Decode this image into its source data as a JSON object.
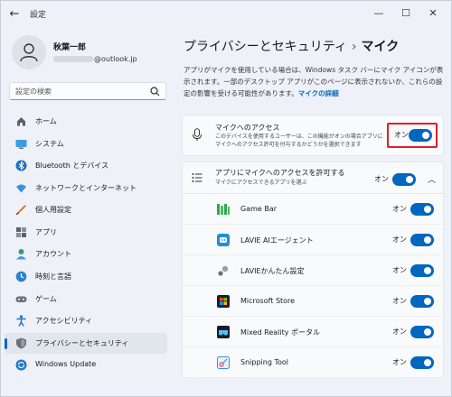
{
  "window": {
    "title": "設定"
  },
  "user": {
    "name": "秋葉一郎",
    "email_suffix": "@outlook.jp"
  },
  "search": {
    "placeholder": "設定の検索"
  },
  "nav": [
    {
      "label": "ホーム",
      "icon": "home-icon"
    },
    {
      "label": "システム",
      "icon": "system-icon"
    },
    {
      "label": "Bluetooth とデバイス",
      "icon": "bluetooth-icon"
    },
    {
      "label": "ネットワークとインターネット",
      "icon": "network-icon"
    },
    {
      "label": "個人用設定",
      "icon": "personalization-icon"
    },
    {
      "label": "アプリ",
      "icon": "apps-icon"
    },
    {
      "label": "アカウント",
      "icon": "accounts-icon"
    },
    {
      "label": "時刻と言語",
      "icon": "time-language-icon"
    },
    {
      "label": "ゲーム",
      "icon": "gaming-icon"
    },
    {
      "label": "アクセシビリティ",
      "icon": "accessibility-icon"
    },
    {
      "label": "プライバシーとセキュリティ",
      "icon": "privacy-shield-icon",
      "active": true
    },
    {
      "label": "Windows Update",
      "icon": "windows-update-icon"
    }
  ],
  "breadcrumb": {
    "parent": "プライバシーとセキュリティ",
    "separator": "›",
    "current": "マイク"
  },
  "description": {
    "text": "アプリがマイクを使用している場合は、Windows タスク バーにマイク アイコンが表示されます。一部のデスクトップ アプリがこのページに表示されないか、これらの設定の影響を受ける可能性があります。",
    "link": "マイクの詳細"
  },
  "microphone_access": {
    "title": "マイクへのアクセス",
    "subtitle": "このデバイスを使用するユーザーは、この機能がオンの場合アプリにマイクへのアクセス許可を付与するかどうかを選択できます",
    "toggle_label": "オン",
    "enabled": true
  },
  "app_access": {
    "title": "アプリにマイクへのアクセスを許可する",
    "subtitle": "マイクにアクセスできるアプリを選ぶ",
    "toggle_label": "オン",
    "enabled": true
  },
  "apps": [
    {
      "name": "Game Bar",
      "toggle_label": "オン",
      "enabled": true,
      "icon": "game-bar-icon"
    },
    {
      "name": "LAVIE AIエージェント",
      "toggle_label": "オン",
      "enabled": true,
      "icon": "lavie-ai-icon"
    },
    {
      "name": "LAVIEかんたん設定",
      "toggle_label": "オン",
      "enabled": true,
      "icon": "lavie-settings-icon"
    },
    {
      "name": "Microsoft Store",
      "toggle_label": "オン",
      "enabled": true,
      "icon": "store-icon"
    },
    {
      "name": "Mixed Reality ポータル",
      "toggle_label": "オン",
      "enabled": true,
      "icon": "mixed-reality-icon"
    },
    {
      "name": "Snipping Tool",
      "toggle_label": "オン",
      "enabled": true,
      "icon": "snipping-tool-icon"
    }
  ],
  "colors": {
    "accent": "#0067c0",
    "highlight": "#e31e24"
  }
}
